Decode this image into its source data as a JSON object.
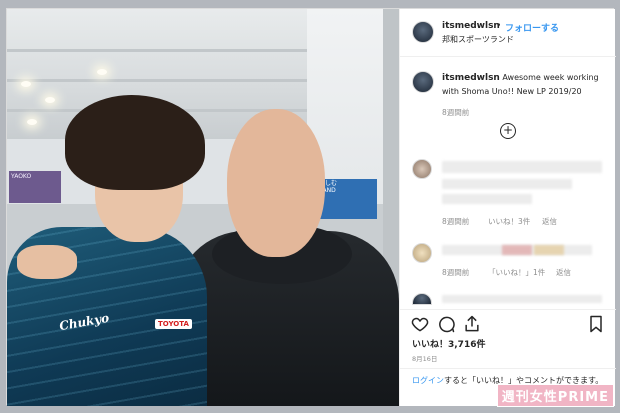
{
  "post": {
    "username": "itsmedwlsn",
    "separator": "•",
    "follow_label": "フォローする",
    "location": "邦和スポーツランド",
    "caption": "Awesome week working with Shoma Uno!! New LP 2019/20",
    "caption_time": "8週間前",
    "comments": [
      {
        "time": "8週間前",
        "likes": "いいね！3件",
        "reply": "返信"
      },
      {
        "time": "8週間前",
        "likes": "「いいね！」1件",
        "reply": "返信"
      }
    ],
    "like_count": "いいね！3,716件",
    "date": "8月16日",
    "login_prefix": "ログイン",
    "login_suffix": "すると「いいね！」やコメントができます。"
  },
  "photo": {
    "jacket_logo": "Chukyo",
    "jacket_sponsor": "TOYOTA",
    "sign_left": "YAOKO",
    "sign_right_1": "楽しむ",
    "sign_right_2": "LAND"
  },
  "watermark": {
    "text": "週刊女性",
    "brand": "PRIME"
  },
  "icons": [
    "heart-icon",
    "comment-icon",
    "share-icon",
    "bookmark-icon",
    "plus-circle-icon"
  ],
  "colors": {
    "link": "#3897f0",
    "text": "#262626",
    "muted": "#8e8e8e"
  }
}
